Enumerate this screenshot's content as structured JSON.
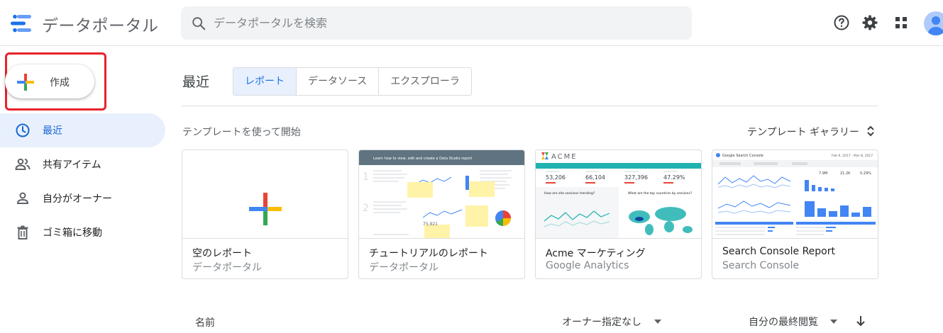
{
  "header": {
    "app_title": "データポータル",
    "search_placeholder": "データポータルを検索",
    "icons": [
      "help-icon",
      "settings-icon",
      "apps-grid-icon",
      "account-avatar"
    ]
  },
  "sidebar": {
    "create_label": "作成",
    "items": [
      {
        "label": "最近",
        "icon": "clock-icon",
        "active": true
      },
      {
        "label": "共有アイテム",
        "icon": "people-icon",
        "active": false
      },
      {
        "label": "自分がオーナー",
        "icon": "person-icon",
        "active": false
      },
      {
        "label": "ゴミ箱に移動",
        "icon": "trash-icon",
        "active": false
      }
    ]
  },
  "main": {
    "section_title": "最近",
    "tabs": [
      {
        "label": "レポート",
        "active": true
      },
      {
        "label": "データソース",
        "active": false
      },
      {
        "label": "エクスプローラ",
        "active": false
      }
    ],
    "templates_heading": "テンプレートを使って開始",
    "gallery_label": "テンプレート ギャラリー",
    "templates": [
      {
        "title": "空のレポート",
        "subtitle": "データポータル"
      },
      {
        "title": "チュートリアルのレポート",
        "subtitle": "データポータル"
      },
      {
        "title": "Acme マーケティング",
        "subtitle": "Google Analytics"
      },
      {
        "title": "Search Console Report",
        "subtitle": "Search Console"
      }
    ],
    "list_header": {
      "name": "名前",
      "owner_filter": "オーナー指定なし",
      "sort": "自分の最終閲覧"
    }
  },
  "thumbnails": {
    "tutorial": {
      "banner": "Learn how to view, edit and create a Data Studio report",
      "metric": "75,921"
    },
    "acme": {
      "brand": "ACME",
      "metrics": [
        "53,206",
        "66,104",
        "327,396",
        "47.29%"
      ],
      "chart_left_title": "How are site sessions trending?",
      "chart_right_title": "What are the top countries by sessions?"
    },
    "search_console": {
      "brand": "Google Search Console",
      "date_range": "Feb 9, 2017 - Mar 8, 2017",
      "metrics": [
        "7.9M",
        "21.2K",
        "0.29%"
      ]
    }
  },
  "colors": {
    "accent": "#1a73e8",
    "active_bg": "#e8f0fe",
    "highlight": "#e8222a",
    "acme_teal": "#1fb2b0",
    "tutorial_banner": "#5f7480",
    "plus_red": "#ea4335",
    "plus_blue": "#4285f4",
    "plus_yellow": "#fbbc04",
    "plus_green": "#34a853"
  }
}
